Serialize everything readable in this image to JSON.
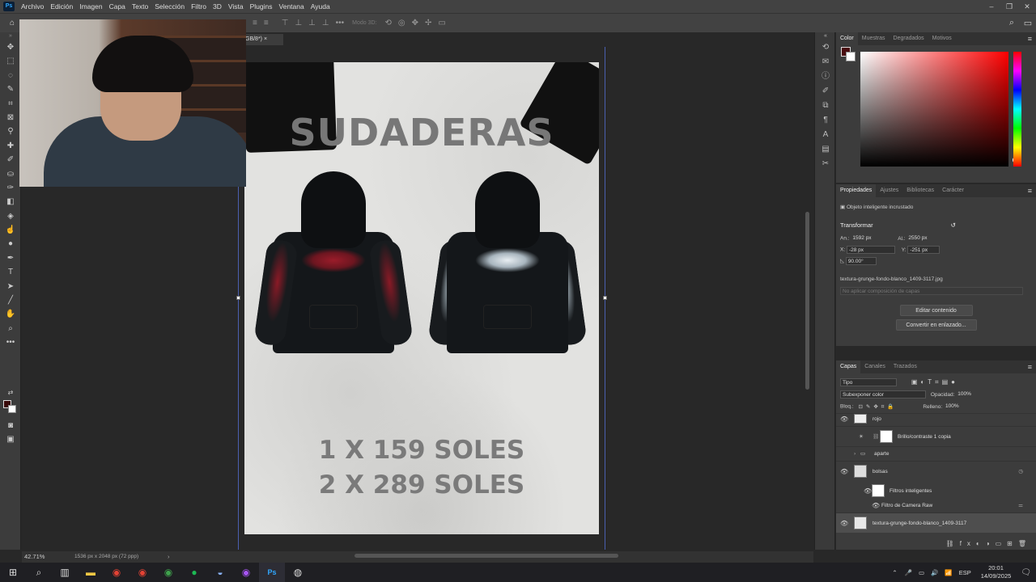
{
  "menu": {
    "app_icon": "Ps",
    "items": [
      "Archivo",
      "Edición",
      "Imagen",
      "Capa",
      "Texto",
      "Selección",
      "Filtro",
      "3D",
      "Vista",
      "Plugins",
      "Ventana",
      "Ayuda"
    ]
  },
  "options_bar": {
    "mode_3d": "Modo 3D:"
  },
  "document": {
    "tab_label": "GB/8*)",
    "tab_close": "×",
    "title_text": "SUDADERAS",
    "price_line1": "1 X 159 SOLES",
    "price_line2": "2 X 289 SOLES"
  },
  "status": {
    "zoom": "42.71%",
    "doc_info": "1536 px x 2048 px (72 ppp)"
  },
  "color_panel": {
    "tabs": [
      "Color",
      "Muestras",
      "Degradados",
      "Motivos"
    ]
  },
  "properties_panel": {
    "tabs": [
      "Propiedades",
      "Ajustes",
      "Bibliotecas",
      "Carácter"
    ],
    "type_label": "Objeto inteligente incrustado",
    "transform_heading": "Transformar",
    "w_label": "An.:",
    "w_value": "1592 px",
    "h_label": "Al.:",
    "h_value": "2550 px",
    "x_label": "X:",
    "x_value": "-28 px",
    "y_label": "Y:",
    "y_value": "-251 px",
    "angle_value": "90.00°",
    "filename": "textura-grunge-fondo-blanco_1409-3117.jpg",
    "comp_placeholder": "No aplicar composición de capas",
    "edit_button": "Editar contenido",
    "convert_button": "Convertir en enlazado..."
  },
  "layers_panel": {
    "tabs": [
      "Capas",
      "Canales",
      "Trazados"
    ],
    "filter_kind": "Tipo",
    "blend_mode": "Subexponer color",
    "opacity_label": "Opacidad:",
    "opacity_value": "100%",
    "lock_label": "Bloq.:",
    "fill_label": "Relleno:",
    "fill_value": "100%",
    "layers": [
      {
        "name": "rojo"
      },
      {
        "name": "Brillo/contraste 1 copia"
      },
      {
        "name": "aparte"
      },
      {
        "name": "bolsas"
      },
      {
        "name": "Filtros inteligentes"
      },
      {
        "name": "Filtro de Camera Raw"
      },
      {
        "name": "textura-grunge-fondo-blanco_1409-3117"
      }
    ]
  },
  "taskbar": {
    "ps_label": "Ps",
    "lang": "ESP",
    "time": "20:01",
    "date": "14/09/2025"
  }
}
